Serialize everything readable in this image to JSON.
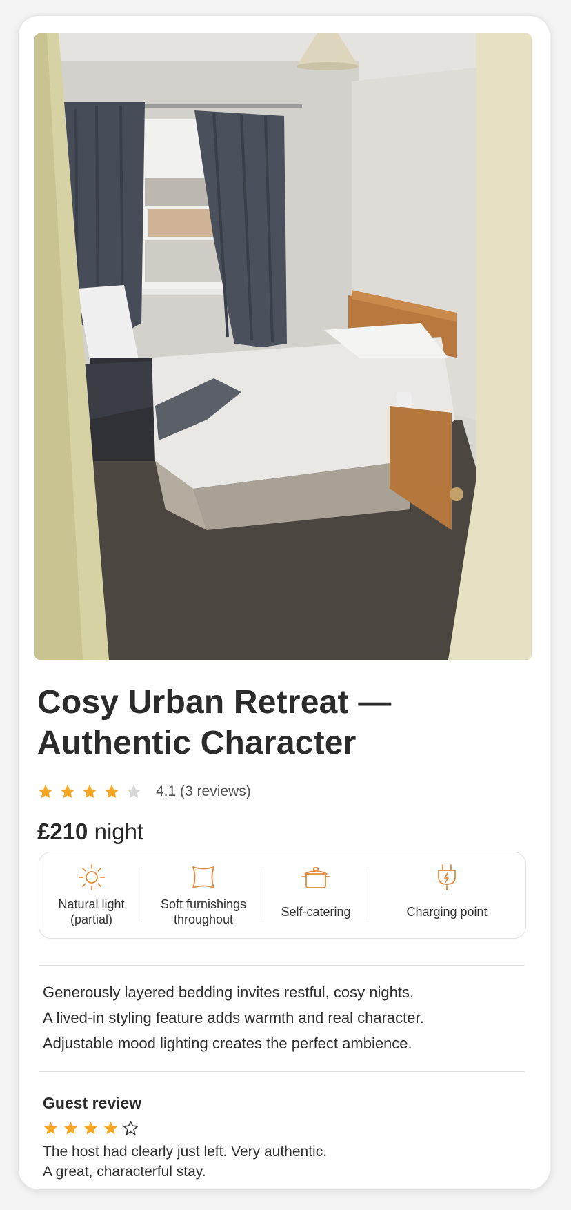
{
  "listing": {
    "title_line1": "Cosy Urban Retreat —",
    "title_line2": "Authentic Character",
    "rating": 4.1,
    "rating_text": "4.1 (3 reviews)",
    "price_amount": "£210",
    "price_unit": "night"
  },
  "amenities": [
    {
      "icon": "sun-icon",
      "line1": "Natural light",
      "line2": "(partial)"
    },
    {
      "icon": "cushion-icon",
      "line1": "Soft furnishings",
      "line2": "throughout"
    },
    {
      "icon": "cooking-pot-icon",
      "line1": "Self-catering",
      "line2": ""
    },
    {
      "icon": "plug-icon",
      "line1": "Charging point",
      "line2": ""
    }
  ],
  "description": [
    "Generously layered bedding invites restful, cosy nights.",
    "A lived-in styling feature adds warmth and real character.",
    "Adjustable mood lighting creates the perfect ambience."
  ],
  "review": {
    "heading": "Guest review",
    "stars": 4,
    "line1": "The host had clearly just left. Very authentic.",
    "line2": "A great, characterful stay."
  },
  "colors": {
    "star": "#f5a623",
    "star_empty": "#d6d6d6",
    "icon": "#e38a3a",
    "text": "#2b2b2b"
  }
}
